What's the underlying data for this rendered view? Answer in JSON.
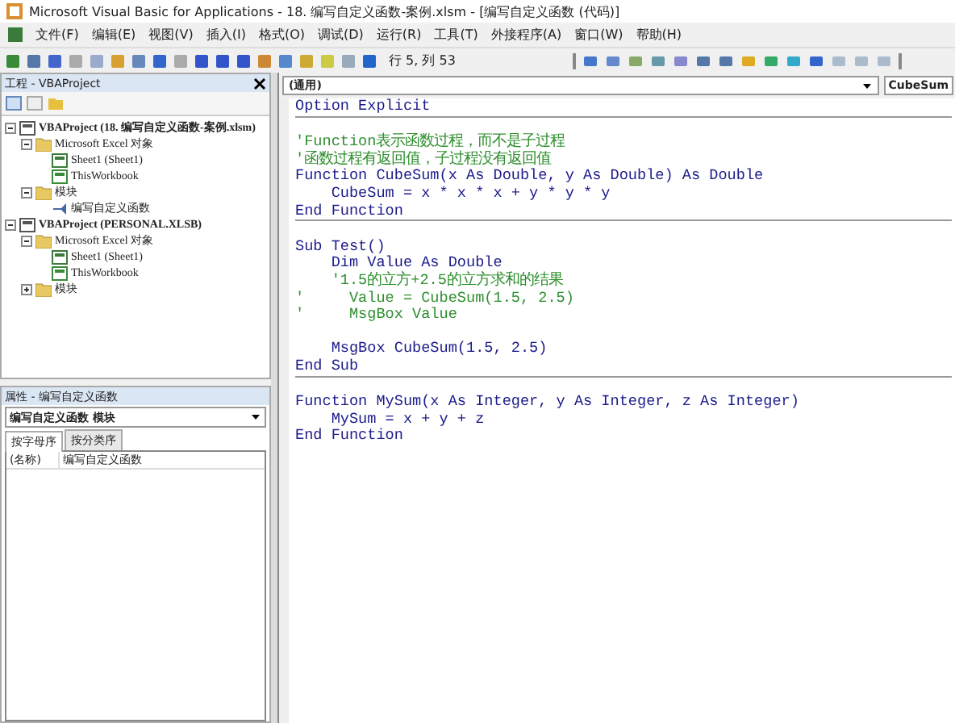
{
  "window": {
    "title": "Microsoft Visual Basic for Applications - 18. 编写自定义函数-案例.xlsm - [编写自定义函数 (代码)]"
  },
  "menu": [
    "文件(F)",
    "编辑(E)",
    "视图(V)",
    "插入(I)",
    "格式(O)",
    "调试(D)",
    "运行(R)",
    "工具(T)",
    "外接程序(A)",
    "窗口(W)",
    "帮助(H)"
  ],
  "toolbar": {
    "position": "行 5, 列 53"
  },
  "project_pane": {
    "title": "工程 - VBAProject",
    "tree": [
      {
        "label": "VBAProject (18. 编写自定义函数-案例.xlsm)",
        "kind": "project",
        "expanded": true,
        "children": [
          {
            "label": "Microsoft Excel 对象",
            "kind": "folder",
            "expanded": true,
            "children": [
              {
                "label": "Sheet1 (Sheet1)",
                "kind": "sheet"
              },
              {
                "label": "ThisWorkbook",
                "kind": "workbook"
              }
            ]
          },
          {
            "label": "模块",
            "kind": "folder",
            "expanded": true,
            "children": [
              {
                "label": "编写自定义函数",
                "kind": "module"
              }
            ]
          }
        ]
      },
      {
        "label": "VBAProject (PERSONAL.XLSB)",
        "kind": "project",
        "expanded": true,
        "children": [
          {
            "label": "Microsoft Excel 对象",
            "kind": "folder",
            "expanded": true,
            "children": [
              {
                "label": "Sheet1 (Sheet1)",
                "kind": "sheet"
              },
              {
                "label": "ThisWorkbook",
                "kind": "workbook"
              }
            ]
          },
          {
            "label": "模块",
            "kind": "folder",
            "expanded": false
          }
        ]
      }
    ]
  },
  "properties_pane": {
    "title": "属性 - 编写自定义函数",
    "object": "编写自定义函数 模块",
    "tabs": [
      {
        "label": "按字母序",
        "selected": true
      },
      {
        "label": "按分类序",
        "selected": false
      }
    ],
    "rows": [
      {
        "name": "(名称)",
        "value": "编写自定义函数"
      }
    ]
  },
  "code_window": {
    "object": "(通用)",
    "procedure": "CubeSum",
    "blocks": [
      [
        {
          "text": "Option Explicit",
          "kind": "code"
        }
      ],
      [
        {
          "kind": "blank"
        },
        {
          "text": "'Function表示函数过程，而不是子过程",
          "kind": "comment"
        },
        {
          "text": "'函数过程有返回值，子过程没有返回值",
          "kind": "comment"
        },
        {
          "text": "Function CubeSum(x As Double, y As Double) As Double",
          "kind": "code"
        },
        {
          "text": "    CubeSum = x * x * x + y * y * y",
          "kind": "code"
        },
        {
          "text": "End Function",
          "kind": "code"
        }
      ],
      [
        {
          "kind": "blank"
        },
        {
          "text": "Sub Test()",
          "kind": "code"
        },
        {
          "text": "    Dim Value As Double",
          "kind": "code"
        },
        {
          "text": "    '1.5的立方+2.5的立方求和的结果",
          "kind": "comment"
        },
        {
          "text": "'     Value = CubeSum(1.5, 2.5)",
          "kind": "comment"
        },
        {
          "text": "'     MsgBox Value",
          "kind": "comment"
        },
        {
          "kind": "blank"
        },
        {
          "text": "    MsgBox CubeSum(1.5, 2.5)",
          "kind": "code"
        },
        {
          "text": "End Sub",
          "kind": "code"
        }
      ],
      [
        {
          "kind": "blank"
        },
        {
          "text": "Function MySum(x As Integer, y As Integer, z As Integer)",
          "kind": "code"
        },
        {
          "text": "    MySum = x + y + z",
          "kind": "code"
        },
        {
          "text": "End Function",
          "kind": "code"
        }
      ]
    ]
  }
}
